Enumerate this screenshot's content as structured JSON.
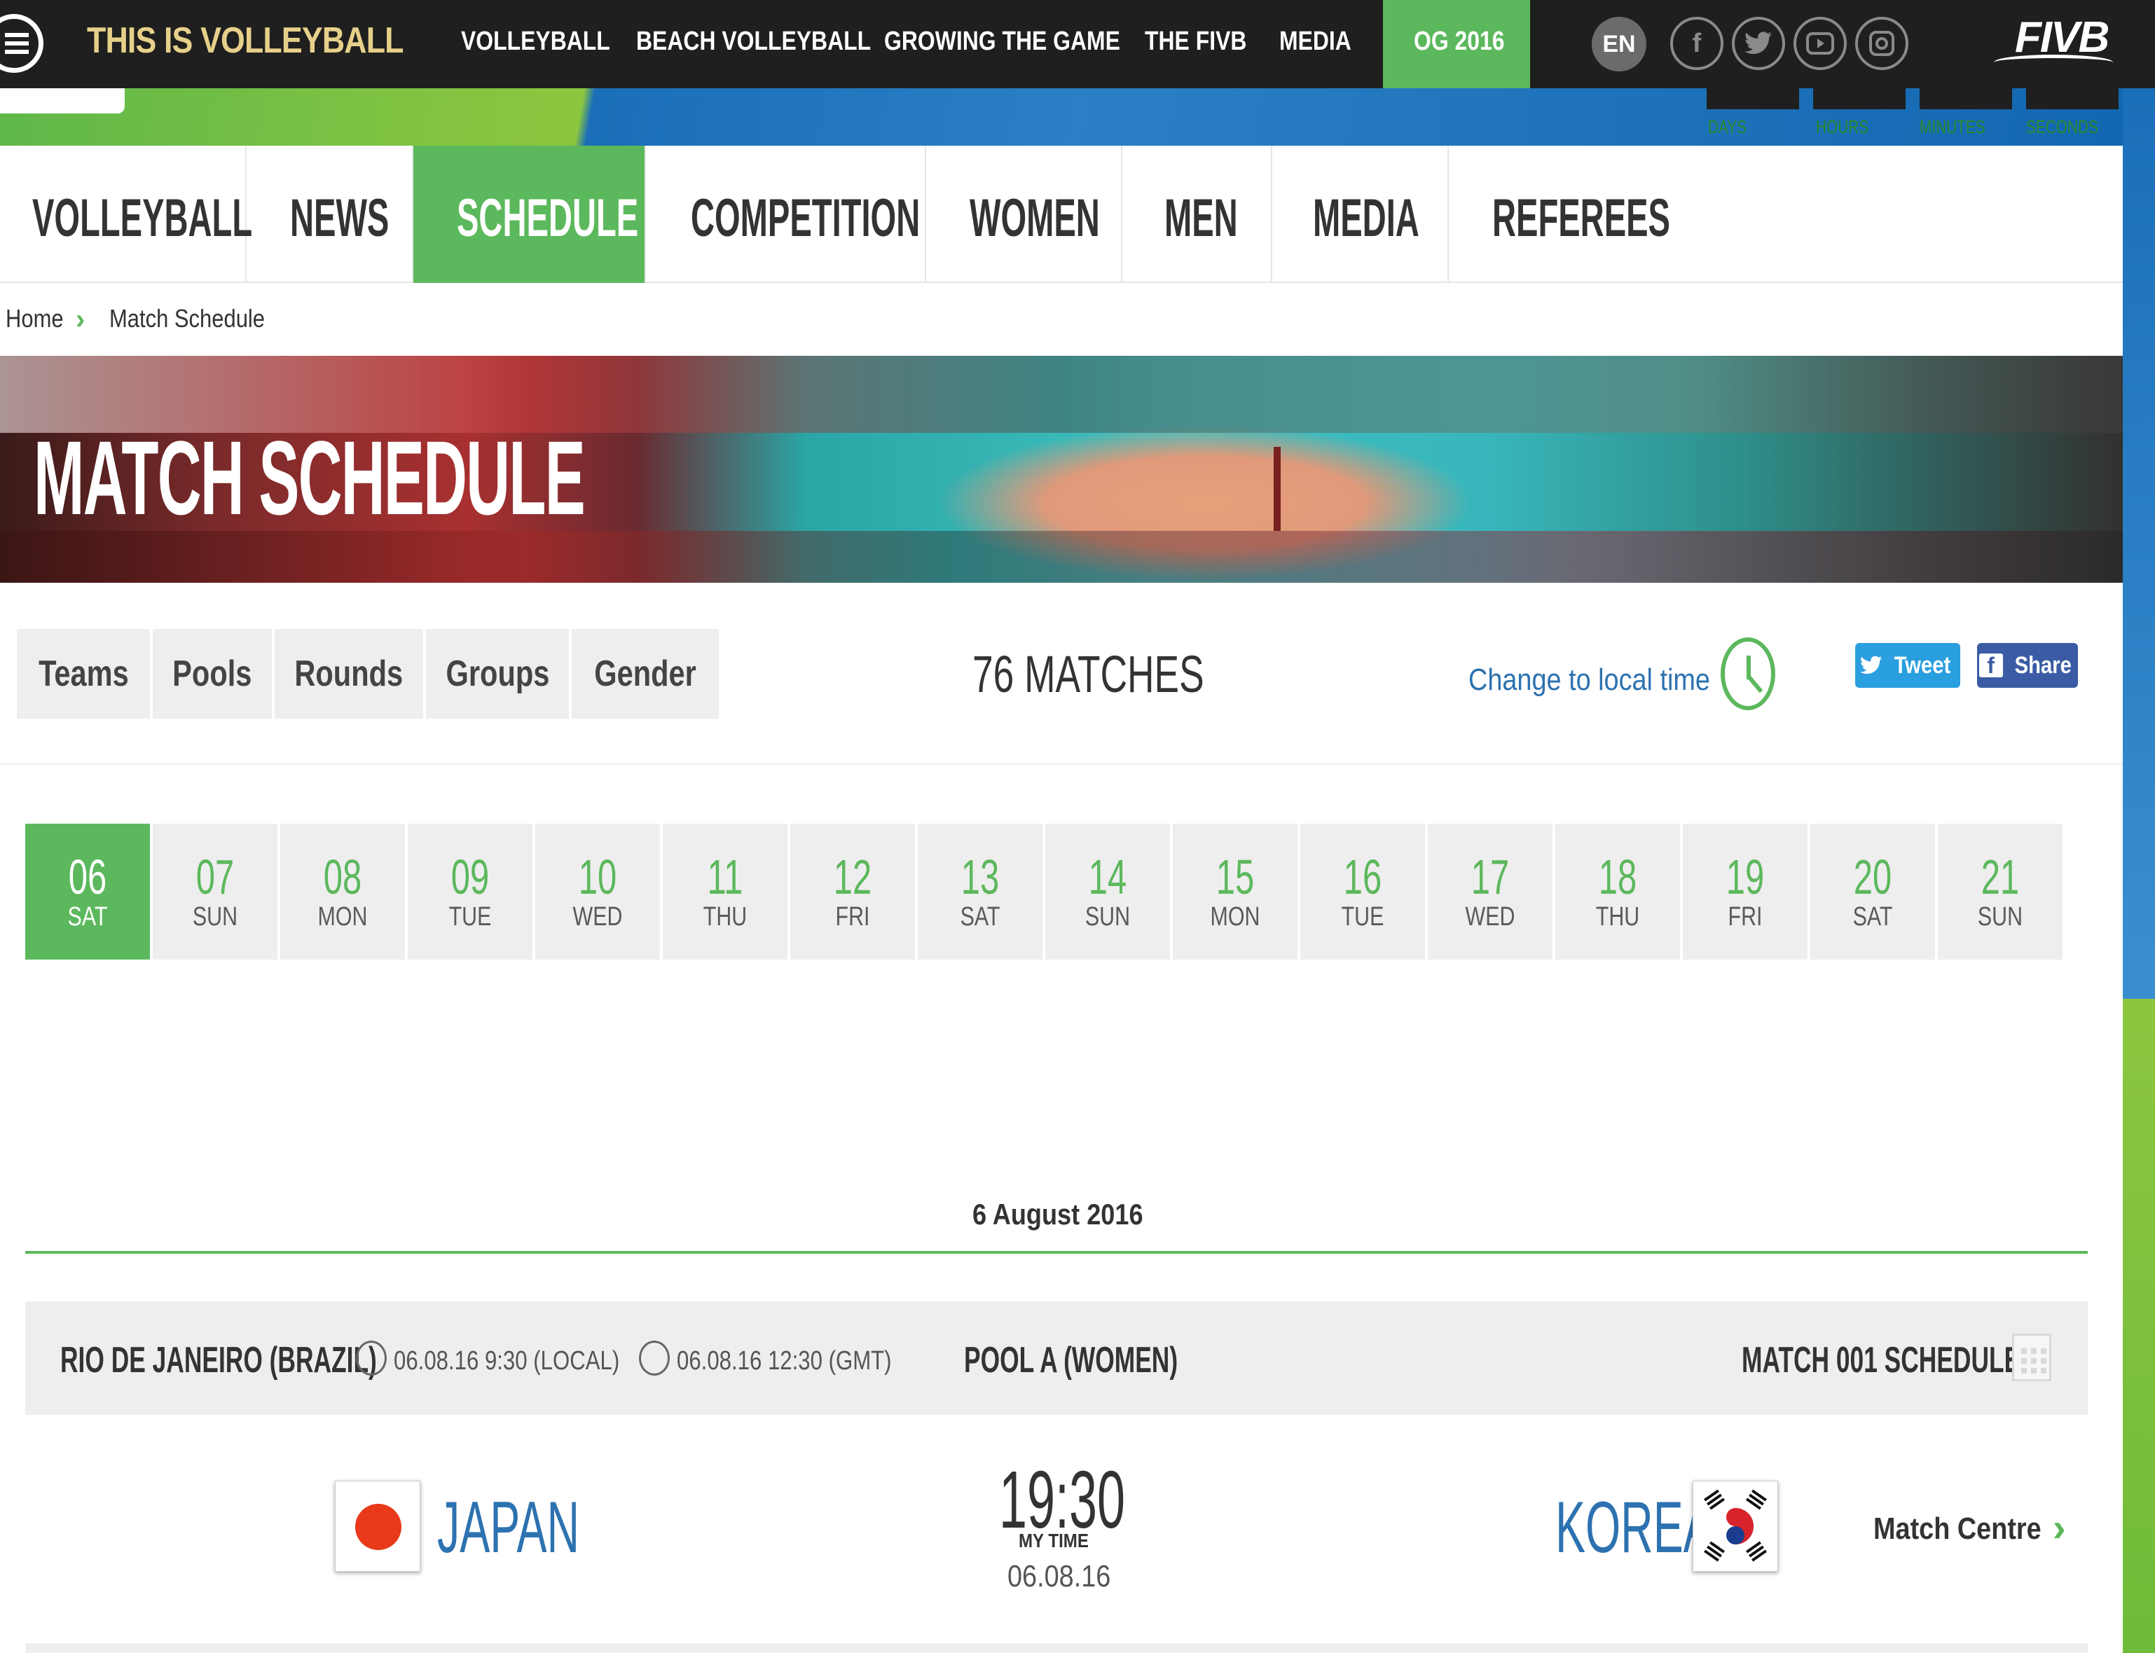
{
  "top_nav": {
    "brand": "THIS IS VOLLEYBALL",
    "items": [
      "VOLLEYBALL",
      "BEACH VOLLEYBALL",
      "GROWING THE GAME",
      "THE FIVB",
      "MEDIA"
    ],
    "active_item": "OG 2016",
    "language": "EN",
    "social_icons": [
      "facebook-icon",
      "twitter-icon",
      "youtube-icon",
      "instagram-icon"
    ],
    "logo": "FIVB"
  },
  "countdown": {
    "labels": [
      "DAYS",
      "HOURS",
      "MINUTES",
      "SECONDS"
    ]
  },
  "sub_nav": {
    "items": [
      "VOLLEYBALL",
      "NEWS",
      "SCHEDULE",
      "COMPETITION",
      "WOMEN",
      "MEN",
      "MEDIA",
      "REFEREES"
    ],
    "active": "SCHEDULE"
  },
  "breadcrumb": {
    "home": "Home",
    "current": "Match Schedule"
  },
  "hero": {
    "title": "MATCH SCHEDULE"
  },
  "filters": {
    "items": [
      "Teams",
      "Pools",
      "Rounds",
      "Groups",
      "Gender"
    ],
    "match_count": "76 MATCHES",
    "local_time_link": "Change to local time",
    "tweet": "Tweet",
    "share": "Share"
  },
  "days": [
    {
      "num": "06",
      "dow": "SAT",
      "active": true
    },
    {
      "num": "07",
      "dow": "SUN"
    },
    {
      "num": "08",
      "dow": "MON"
    },
    {
      "num": "09",
      "dow": "TUE"
    },
    {
      "num": "10",
      "dow": "WED"
    },
    {
      "num": "11",
      "dow": "THU"
    },
    {
      "num": "12",
      "dow": "FRI"
    },
    {
      "num": "13",
      "dow": "SAT"
    },
    {
      "num": "14",
      "dow": "SUN"
    },
    {
      "num": "15",
      "dow": "MON"
    },
    {
      "num": "16",
      "dow": "TUE"
    },
    {
      "num": "17",
      "dow": "WED"
    },
    {
      "num": "18",
      "dow": "THU"
    },
    {
      "num": "19",
      "dow": "FRI"
    },
    {
      "num": "20",
      "dow": "SAT"
    },
    {
      "num": "21",
      "dow": "SUN"
    }
  ],
  "schedule": {
    "date_header": "6 August 2016",
    "match": {
      "venue": "RIO DE JANEIRO (BRAZIL)",
      "local_time": "06.08.16 9:30 (LOCAL)",
      "gmt_time": "06.08.16 12:30 (GMT)",
      "pool": "POOL A (WOMEN)",
      "status": "MATCH 001 SCHEDULED",
      "home_team": "JAPAN",
      "away_team": "KOREA",
      "kickoff": "19:30",
      "my_time_label": "MY TIME",
      "date": "06.08.16",
      "match_centre": "Match Centre"
    }
  },
  "colors": {
    "accent_green": "#5cb85c",
    "link_blue": "#2d72b0",
    "topbar": "#1f1f1f"
  }
}
